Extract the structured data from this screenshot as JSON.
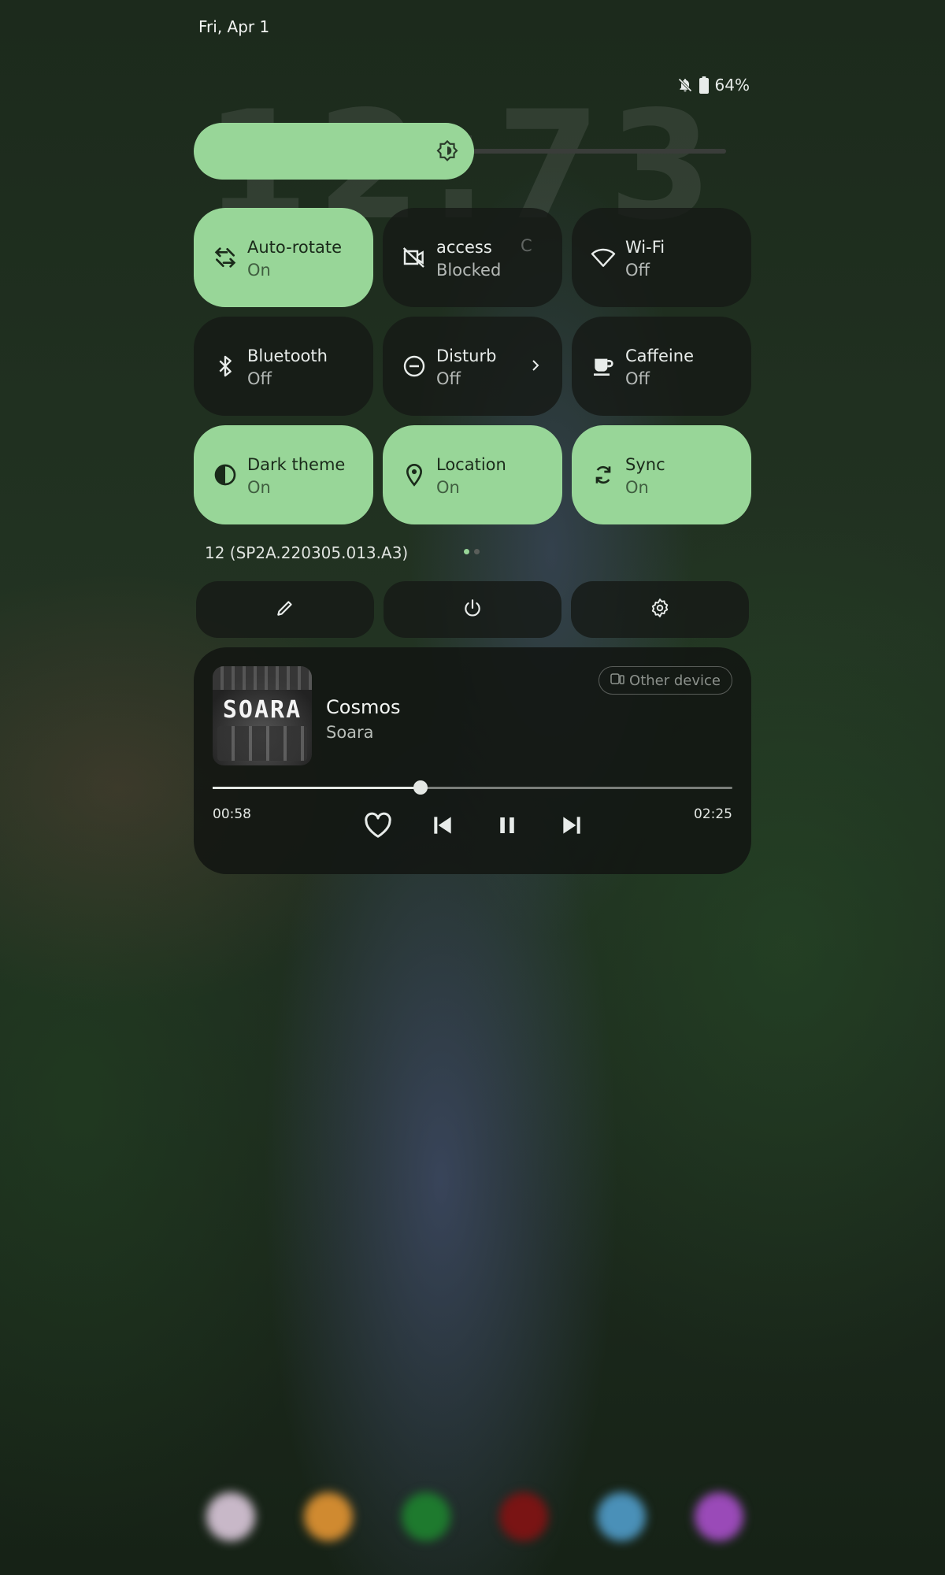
{
  "status_bar": {
    "date": "Fri, Apr 1",
    "battery": "64%",
    "icons": [
      "notifications-off-icon",
      "battery-icon"
    ]
  },
  "brightness": {
    "level": 0.5,
    "icon": "brightness-auto-icon"
  },
  "tiles": [
    {
      "label": "Auto-rotate",
      "state": "On",
      "active": true,
      "icon": "rotate-icon"
    },
    {
      "label": "access",
      "state": "Blocked",
      "ghost": "C",
      "active": false,
      "icon": "camera-off-icon"
    },
    {
      "label": "Wi-Fi",
      "state": "Off",
      "active": false,
      "icon": "wifi-icon"
    },
    {
      "label": "Bluetooth",
      "state": "Off",
      "active": false,
      "icon": "bluetooth-icon"
    },
    {
      "label": "Disturb",
      "state": "Off",
      "active": false,
      "icon": "dnd-icon",
      "has_chevron": true
    },
    {
      "label": "Caffeine",
      "state": "Off",
      "active": false,
      "icon": "coffee-icon"
    },
    {
      "label": "Dark theme",
      "state": "On",
      "active": true,
      "icon": "dark-theme-icon"
    },
    {
      "label": "Location",
      "state": "On",
      "active": true,
      "icon": "location-icon"
    },
    {
      "label": "Sync",
      "state": "On",
      "active": true,
      "icon": "sync-icon"
    }
  ],
  "build": "12 (SP2A.220305.013.A3)",
  "pages": {
    "current": 1,
    "total": 2
  },
  "footer": [
    "edit-icon",
    "power-icon",
    "settings-icon"
  ],
  "media": {
    "title": "Cosmos",
    "artist": "Soara",
    "album_art_text": "SOARA",
    "device": "Other device",
    "elapsed": "00:58",
    "duration": "02:25",
    "progress": 0.4,
    "controls": [
      "heart-icon",
      "skip-previous-icon",
      "pause-icon",
      "skip-next-icon"
    ]
  },
  "colors": {
    "accent": "#98d698",
    "tile_off": "#161a16",
    "text": "#e8ecea"
  }
}
